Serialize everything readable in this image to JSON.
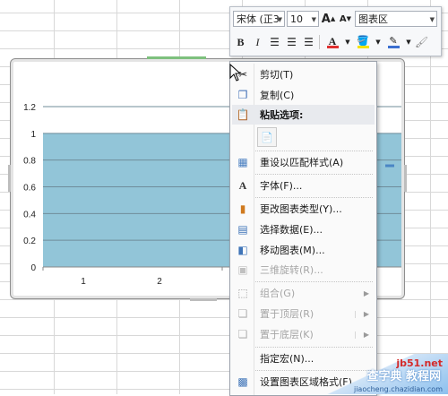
{
  "mini_toolbar": {
    "font_name": "宋体 (正3",
    "font_size": "10",
    "element_name": "图表区",
    "bold": "B",
    "italic": "I",
    "font_color_letter": "A",
    "grow_font": "A",
    "shrink_font": "A",
    "accent_red": "#e03030"
  },
  "chart_data": {
    "type": "bar",
    "categories": [
      "1",
      "2"
    ],
    "values": [
      1,
      1
    ],
    "yticks": [
      "1.2",
      "1",
      "0.8",
      "0.6",
      "0.4",
      "0.2",
      "0"
    ],
    "ylim": [
      0,
      1.2
    ],
    "title": "",
    "xlabel": "",
    "ylabel": "",
    "bar_color": "#92c5d8",
    "grid": true
  },
  "context_menu": {
    "items": [
      {
        "label": "剪切(T)",
        "icon": "scissors-icon",
        "disabled": false
      },
      {
        "label": "复制(C)",
        "icon": "copy-icon",
        "disabled": false
      },
      {
        "label": "粘贴选项:",
        "icon": "paste-icon",
        "disabled": false,
        "header": true
      },
      {
        "label": "重设以匹配样式(A)",
        "icon": "reset-style-icon",
        "disabled": false
      },
      {
        "label": "字体(F)...",
        "icon": "font-icon",
        "disabled": false
      },
      {
        "label": "更改图表类型(Y)...",
        "icon": "chart-type-icon",
        "disabled": false
      },
      {
        "label": "选择数据(E)...",
        "icon": "select-data-icon",
        "disabled": false
      },
      {
        "label": "移动图表(M)...",
        "icon": "move-chart-icon",
        "disabled": false
      },
      {
        "label": "三维旋转(R)...",
        "icon": "rotate-3d-icon",
        "disabled": true
      },
      {
        "label": "组合(G)",
        "icon": "group-icon",
        "disabled": true
      },
      {
        "label": "置于顶层(R)",
        "icon": "bring-front-icon",
        "disabled": true
      },
      {
        "label": "置于底层(K)",
        "icon": "send-back-icon",
        "disabled": true
      },
      {
        "label": "指定宏(N)...",
        "icon": "",
        "disabled": false
      },
      {
        "label": "设置图表区域格式(F)...",
        "icon": "format-chart-icon",
        "disabled": false
      }
    ]
  },
  "watermark": {
    "text": "查字典 教程网",
    "site": "jb51.net",
    "url": "jiaocheng.chazidian.com"
  }
}
